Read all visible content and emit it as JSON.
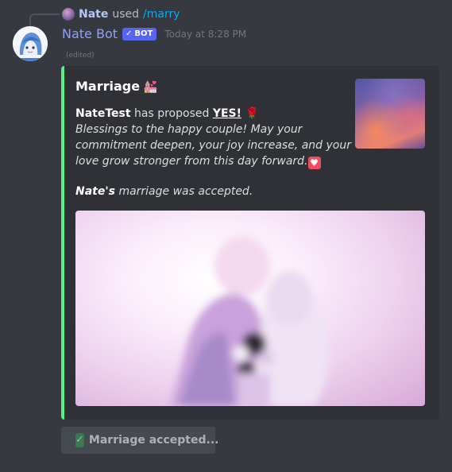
{
  "reply": {
    "username": "Nate",
    "action": "used",
    "command": "/marry"
  },
  "message": {
    "author": "Nate Bot",
    "bot_tag": "BOT",
    "bot_tag_check": "✓",
    "timestamp": "Today at 8:28 PM",
    "edited": "(edited)"
  },
  "embed": {
    "accent_color": "#57f287",
    "title": "Marriage",
    "title_emoji": "💒",
    "proposer": "NateTest",
    "proposed_text": "has proposed",
    "yes": "YES!",
    "rose_emoji": "🌹",
    "blessing_lines": [
      "Blessings to the happy couple! May your",
      "commitment deepen, your joy increase, and your",
      "love grow stronger from this day forward."
    ],
    "heart_emoji": "♥",
    "accepted_name": "Nate's",
    "accepted_text": "marriage was accepted."
  },
  "button": {
    "check": "✓",
    "label": "Marriage accepted..."
  },
  "icons": {
    "reply_avatar": "user-avatar-icon",
    "bot_avatar": "bot-avatar-icon",
    "verified": "checkmark-icon",
    "check_box": "white-check-mark-icon"
  }
}
